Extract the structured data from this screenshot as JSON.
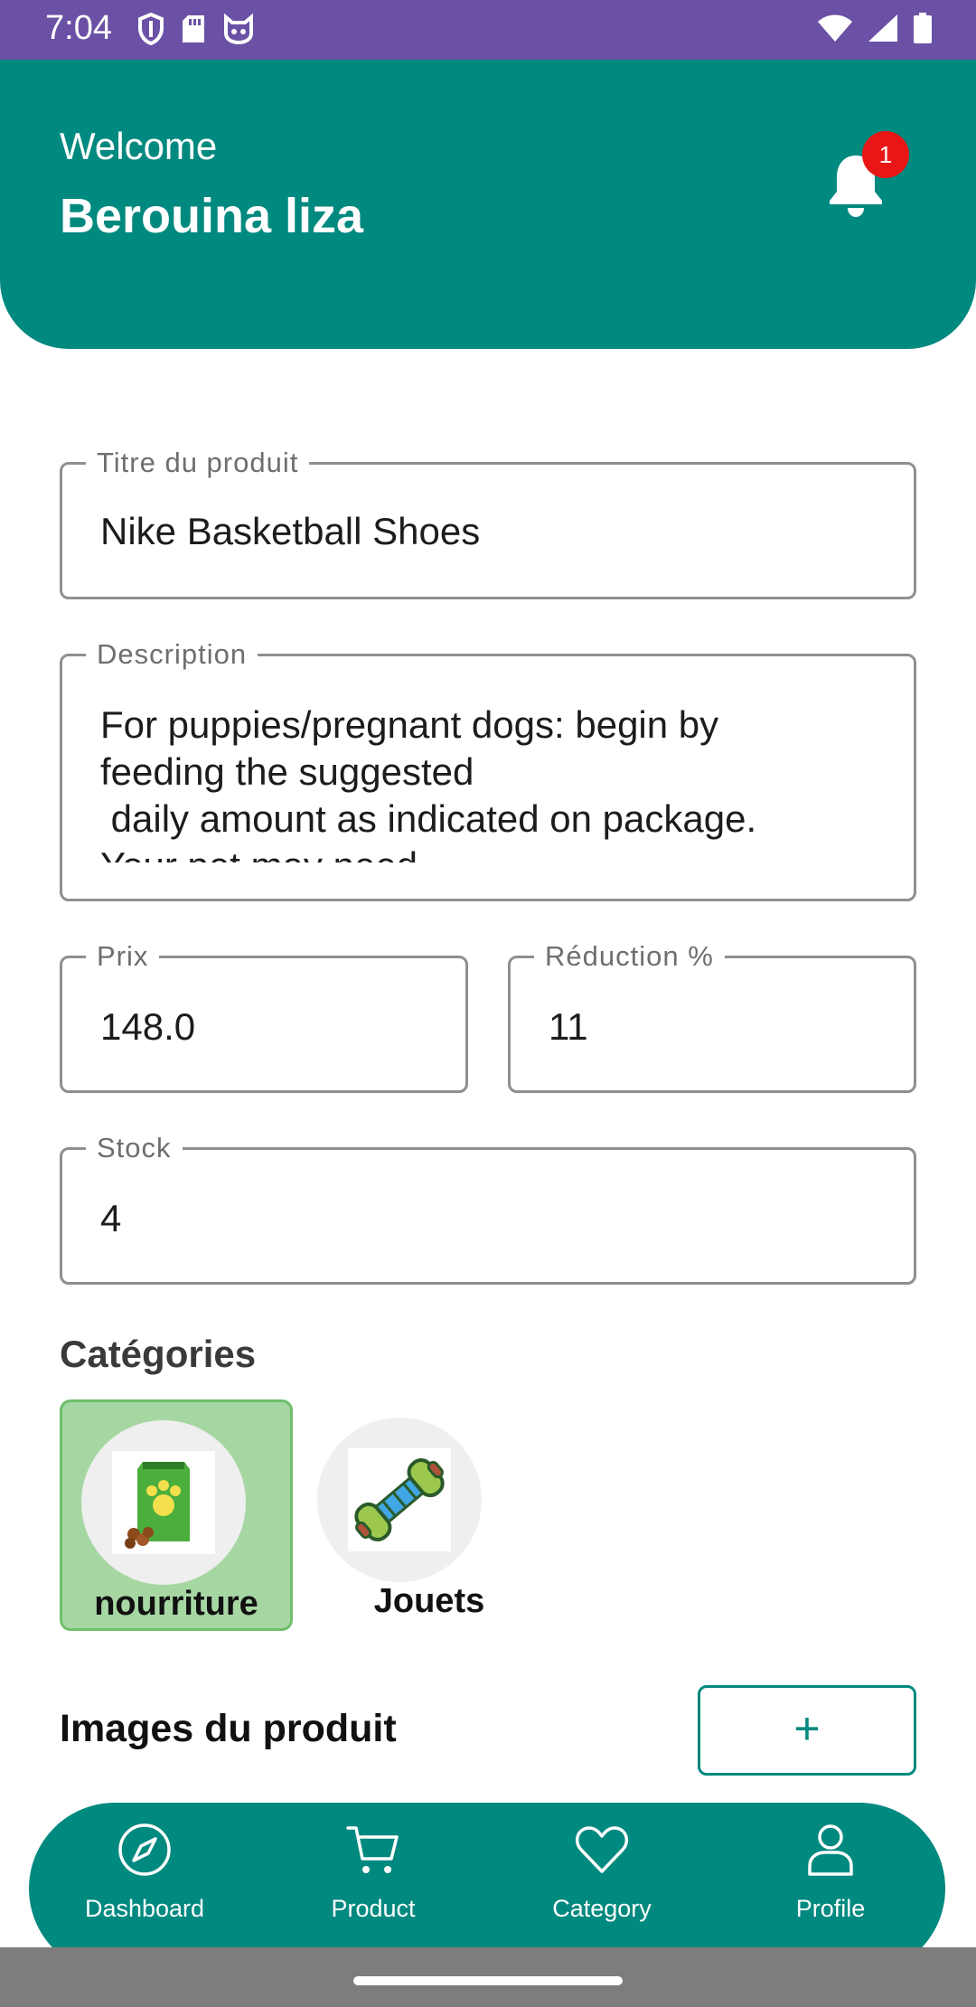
{
  "status_bar": {
    "time": "7:04"
  },
  "header": {
    "welcome": "Welcome",
    "username": "Berouina liza",
    "notification_count": "1"
  },
  "form": {
    "title": {
      "label": "Titre du produit",
      "value": "Nike Basketball Shoes"
    },
    "description": {
      "label": "Description",
      "value": "For puppies/pregnant dogs: begin by\nfeeding the suggested\n daily amount as indicated on package.\nYour pet may need"
    },
    "price": {
      "label": "Prix",
      "value": "148.0"
    },
    "discount": {
      "label": "Réduction %",
      "value": "11"
    },
    "stock": {
      "label": "Stock",
      "value": "4"
    }
  },
  "categories": {
    "title": "Catégories",
    "items": [
      {
        "label": "nourriture",
        "selected": true
      },
      {
        "label": "Jouets",
        "selected": false
      }
    ]
  },
  "images": {
    "title": "Images du produit",
    "add_label": "+"
  },
  "nav": {
    "items": [
      {
        "label": "Dashboard",
        "icon": "compass-icon"
      },
      {
        "label": "Product",
        "icon": "cart-icon"
      },
      {
        "label": "Category",
        "icon": "heart-icon"
      },
      {
        "label": "Profile",
        "icon": "user-icon"
      }
    ]
  },
  "colors": {
    "primary": "#00897f",
    "status_bar": "#6a51a5",
    "badge": "#e81616",
    "selected_category": "#a6d7a3"
  }
}
